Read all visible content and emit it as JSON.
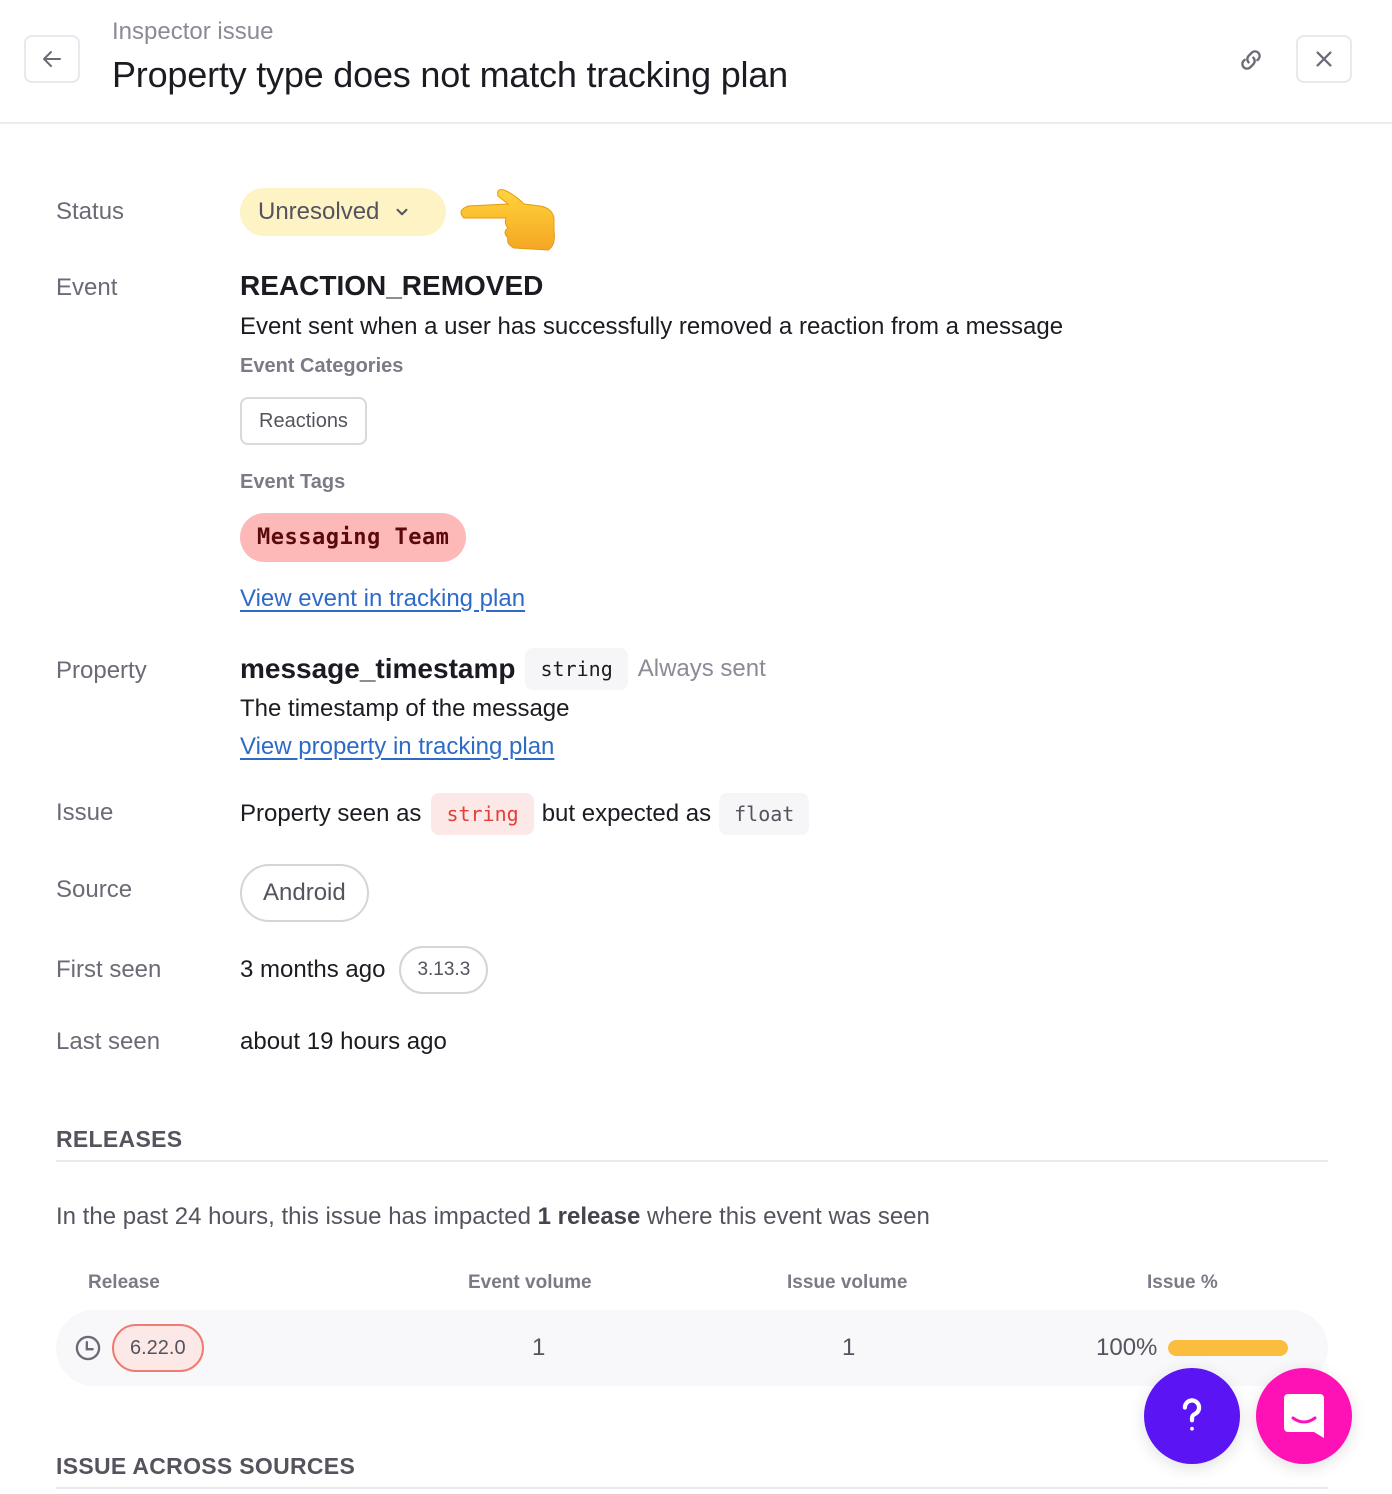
{
  "header": {
    "kicker": "Inspector issue",
    "title": "Property type does not match tracking plan",
    "icons": {
      "back": "arrow-left-icon",
      "link": "link-icon",
      "close": "close-icon"
    }
  },
  "labels": {
    "status": "Status",
    "event": "Event",
    "property": "Property",
    "issue": "Issue",
    "source": "Source",
    "first_seen": "First seen",
    "last_seen": "Last seen"
  },
  "status": {
    "value": "Unresolved",
    "color": "#fdf3c4",
    "decoration": "pointing-left-hand-emoji"
  },
  "event": {
    "name": "REACTION_REMOVED",
    "description": "Event sent when a user has successfully removed a reaction from a message",
    "categories_label": "Event Categories",
    "categories": [
      "Reactions"
    ],
    "tags_label": "Event Tags",
    "tags": [
      {
        "label": "Messaging Team",
        "color": "#fdb8b8"
      }
    ],
    "link": "View event in tracking plan"
  },
  "property": {
    "name": "message_timestamp",
    "type": "string",
    "presence": "Always sent",
    "description": "The timestamp of the message",
    "link": "View property in tracking plan"
  },
  "issue": {
    "prefix": "Property seen as",
    "seen_type": "string",
    "middle": "but expected as",
    "expected_type": "float"
  },
  "source": {
    "value": "Android"
  },
  "first_seen": {
    "value": "3 months ago",
    "version": "3.13.3"
  },
  "last_seen": {
    "value": "about 19 hours ago"
  },
  "releases": {
    "title": "RELEASES",
    "summary_prefix": "In the past 24 hours, this issue has impacted ",
    "summary_bold": "1 release",
    "summary_suffix": " where this event was seen",
    "columns": [
      "Release",
      "Event volume",
      "Issue volume",
      "Issue %"
    ],
    "rows": [
      {
        "release": "6.22.0",
        "event_volume": "1",
        "issue_volume": "1",
        "issue_pct_label": "100%",
        "issue_pct": 100
      }
    ],
    "bar_color": "#fbbd3d"
  },
  "issue_across_sources": {
    "title": "ISSUE ACROSS SOURCES"
  },
  "fabs": {
    "help": {
      "icon": "question-mark-icon",
      "color": "#5b14f4"
    },
    "chat": {
      "icon": "chat-bubble-icon",
      "color": "#ff12b5"
    }
  }
}
